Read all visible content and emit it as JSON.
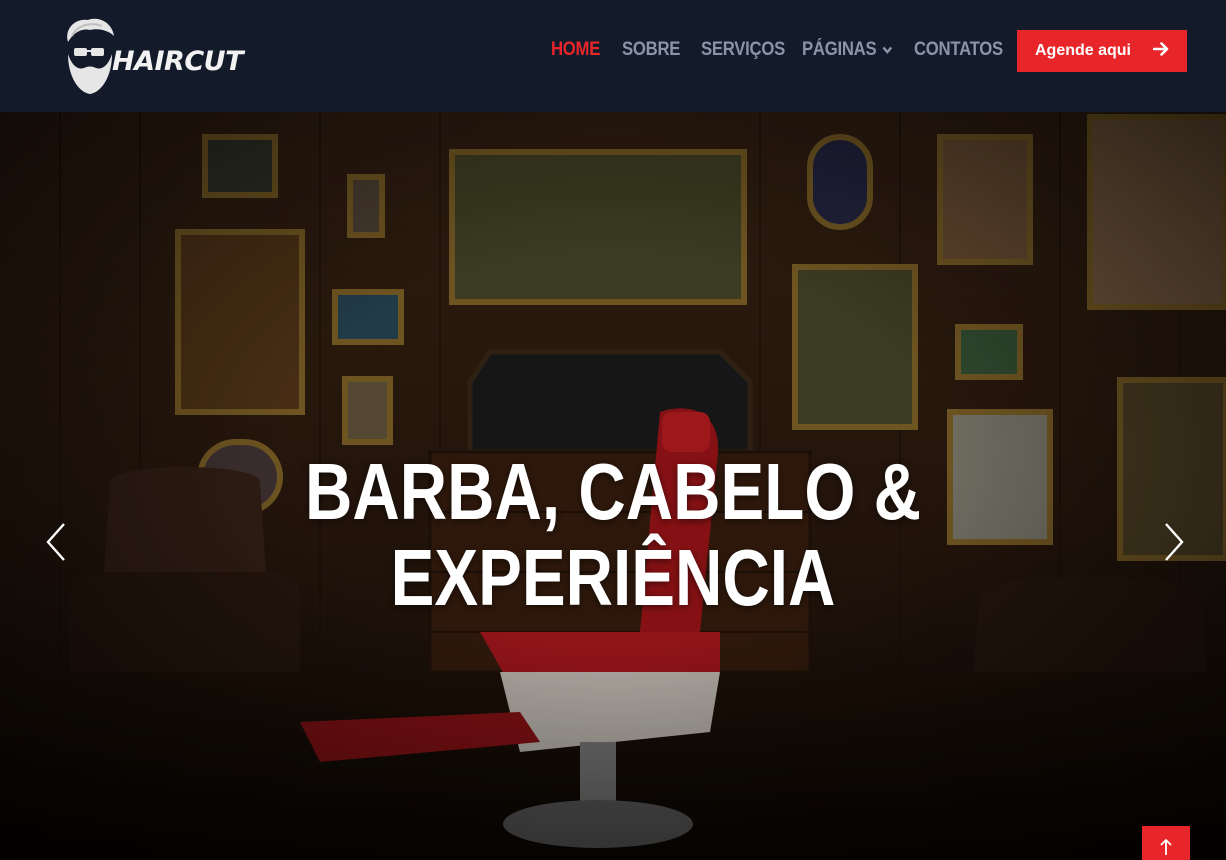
{
  "brand": {
    "name": "HAIRCUT",
    "logo_icon": "bearded-man-icon"
  },
  "nav": {
    "items": [
      {
        "label": "HOME",
        "active": true
      },
      {
        "label": "SOBRE",
        "active": false
      },
      {
        "label": "SERVIÇOS",
        "active": false
      },
      {
        "label": "PÁGINAS",
        "active": false,
        "dropdown": true
      },
      {
        "label": "CONTATOS",
        "active": false
      }
    ],
    "cta_label": "Agende aqui",
    "cta_icon": "arrow-right-icon"
  },
  "hero": {
    "title_line1": "BARBA, CABELO &",
    "title_line2": "EXPERIÊNCIA",
    "prev_icon": "chevron-left-icon",
    "next_icon": "chevron-right-icon"
  },
  "back_to_top_icon": "arrow-up-icon",
  "colors": {
    "accent": "#e8262a",
    "navbar": "#131a2a",
    "nav_text": "#8a93a8"
  }
}
